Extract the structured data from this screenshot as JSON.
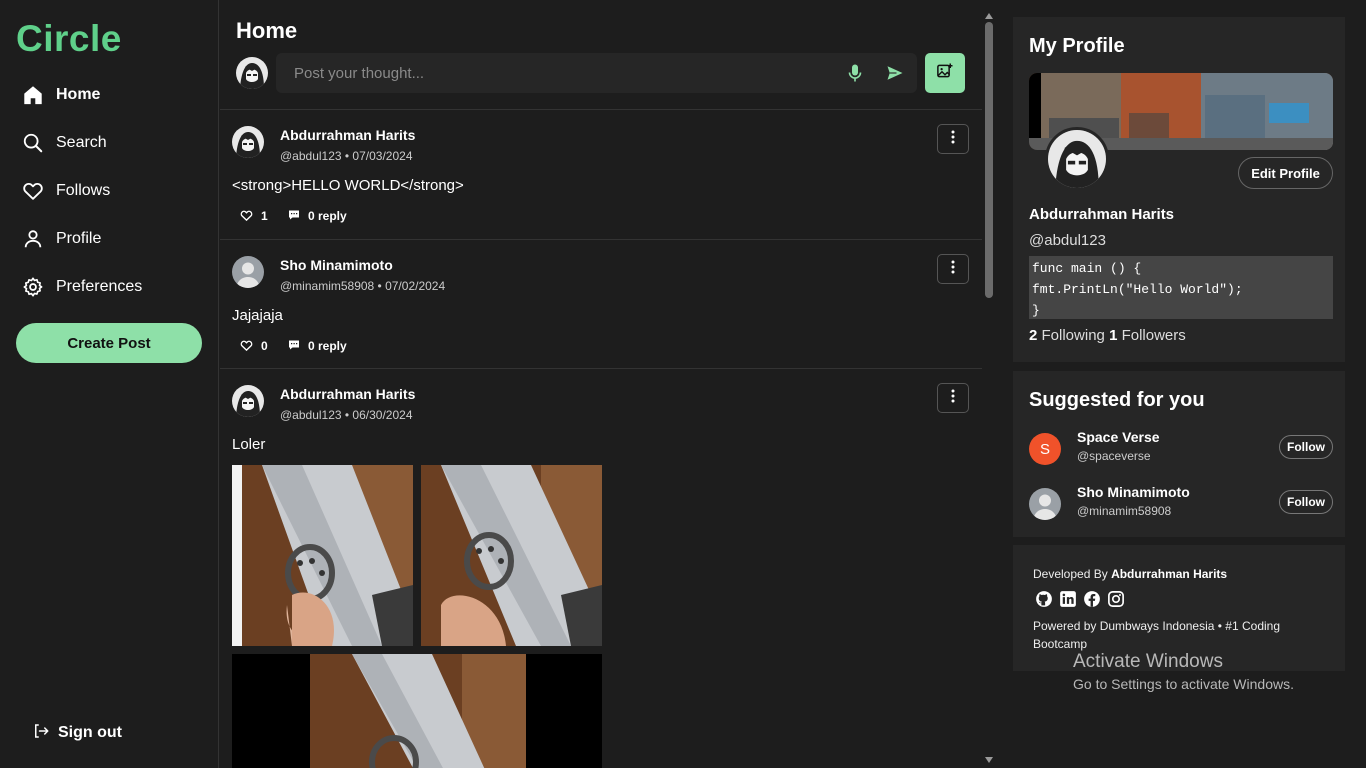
{
  "app": {
    "name": "Circle"
  },
  "nav": [
    {
      "label": "Home",
      "icon": "home-icon",
      "active": true
    },
    {
      "label": "Search",
      "icon": "search-icon"
    },
    {
      "label": "Follows",
      "icon": "heart-icon"
    },
    {
      "label": "Profile",
      "icon": "user-icon"
    },
    {
      "label": "Preferences",
      "icon": "gear-icon"
    }
  ],
  "create_post_label": "Create Post",
  "sign_out_label": "Sign out",
  "main": {
    "title": "Home",
    "composer": {
      "placeholder": "Post your thought..."
    }
  },
  "posts": [
    {
      "author": "Abdurrahman Harits",
      "meta": "@abdul123 • 07/03/2024",
      "content": "<strong>HELLO WORLD</strong>",
      "likes": "1",
      "replies": "0 reply",
      "avatar": "anime"
    },
    {
      "author": "Sho Minamimoto",
      "meta": "@minamim58908 • 07/02/2024",
      "content": "Jajajaja",
      "likes": "0",
      "replies": "0 reply",
      "avatar": "default"
    },
    {
      "author": "Abdurrahman Harits",
      "meta": "@abdul123 • 06/30/2024",
      "content": "Loler",
      "avatar": "anime",
      "images": 3
    }
  ],
  "profile_card": {
    "title": "My Profile",
    "edit_label": "Edit Profile",
    "name": "Abdurrahman Harits",
    "handle": "@abdul123",
    "bio": "func main () {\nfmt.PrintLn(\"Hello World\");\n}",
    "following_count": "2",
    "following_label": "Following",
    "followers_count": "1",
    "followers_label": "Followers"
  },
  "suggested": {
    "title": "Suggested for you",
    "follow_label": "Follow",
    "users": [
      {
        "name": "Space Verse",
        "handle": "@spaceverse",
        "initial": "S",
        "color": "#f0522a"
      },
      {
        "name": "Sho Minamimoto",
        "handle": "@minamim58908",
        "initial": "",
        "color": "#9aa0a6"
      }
    ]
  },
  "footer": {
    "dev_prefix": "Developed By",
    "dev_name": "Abdurrahman Harits",
    "powered": "Powered by Dumbways Indonesia • #1 Coding Bootcamp",
    "icons": [
      "github-icon",
      "linkedin-icon",
      "facebook-icon",
      "instagram-icon"
    ]
  },
  "watermark": {
    "line1": "Activate Windows",
    "line2": "Go to Settings to activate Windows."
  },
  "colors": {
    "accent": "#5fd08a",
    "button": "#8ee0a8",
    "panel": "#262626",
    "bg": "#1d1d1d"
  }
}
